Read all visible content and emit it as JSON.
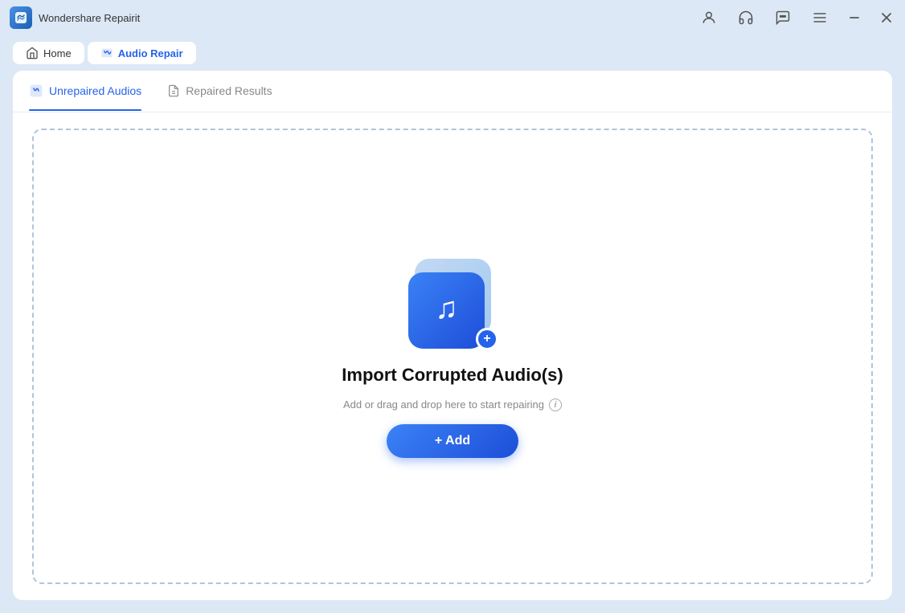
{
  "titlebar": {
    "app_name": "Wondershare Repairit",
    "icon_symbol": "🔧"
  },
  "navbar": {
    "home_label": "Home",
    "active_tab_label": "Audio Repair"
  },
  "tabs": {
    "tab1_label": "Unrepaired Audios",
    "tab2_label": "Repaired Results"
  },
  "dropzone": {
    "title": "Import Corrupted Audio(s)",
    "subtitle": "Add or drag and drop here to start repairing",
    "add_button_label": "+ Add"
  },
  "controls": {
    "minimize": "—",
    "close": "✕"
  }
}
